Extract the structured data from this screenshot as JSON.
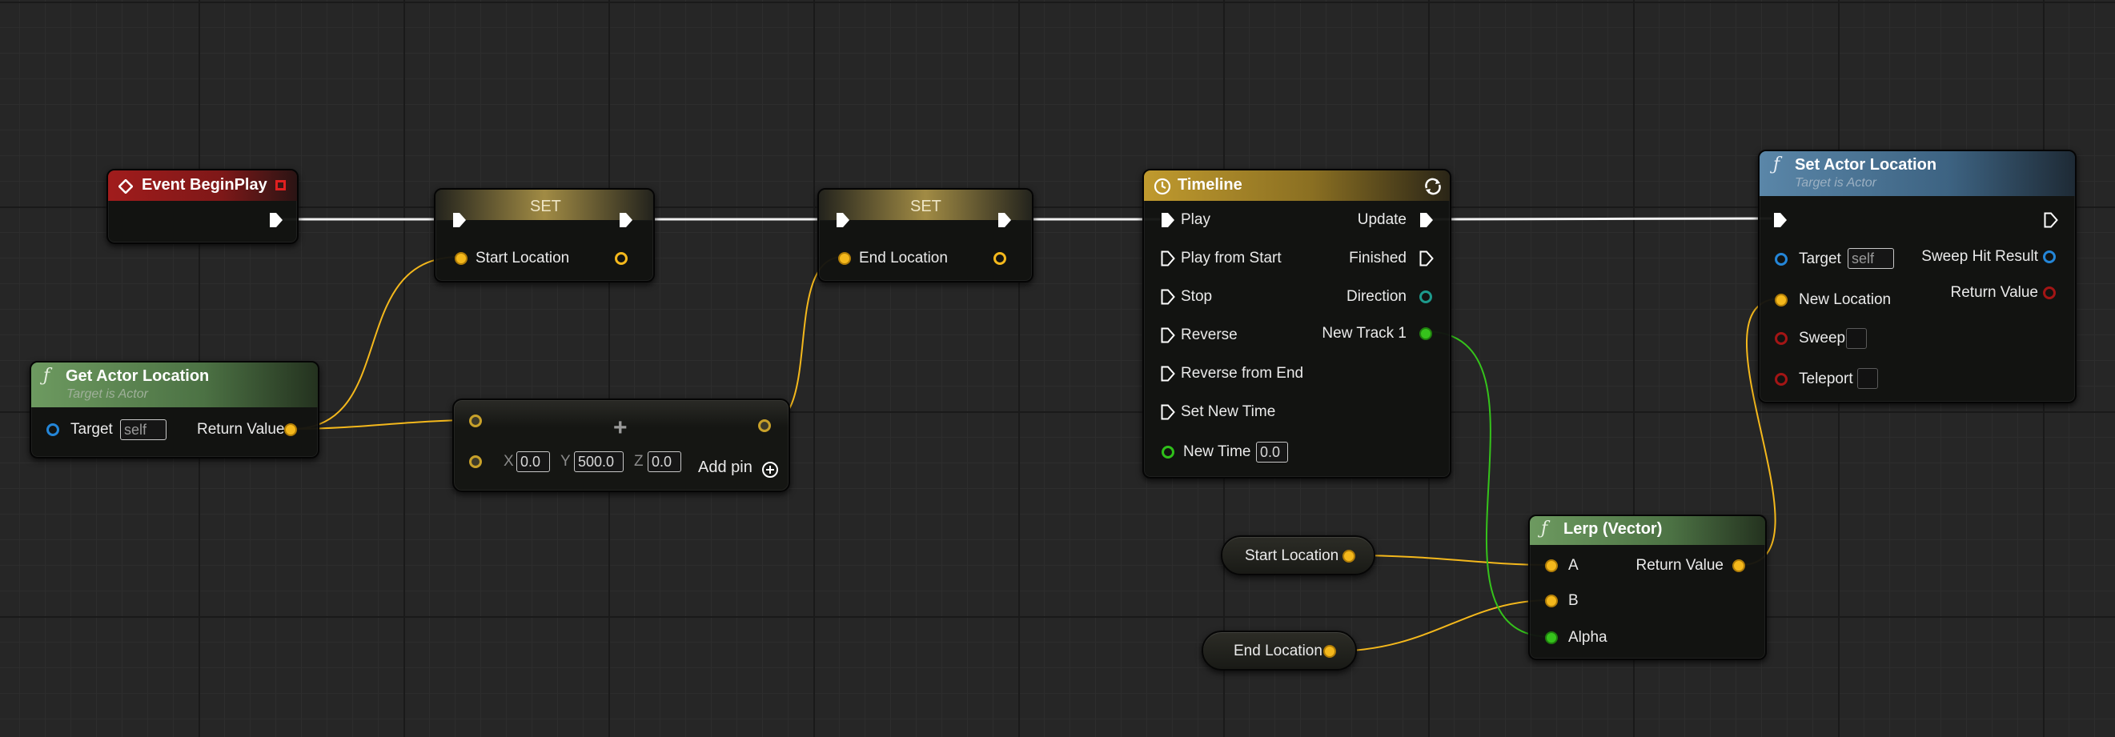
{
  "colors": {
    "exec_wire": "#f2f2f2",
    "vector_wire": "#f4b81c",
    "float_wire": "#35c31b",
    "event_header": "#9a1a1a",
    "function_header": "#6f9a62",
    "set_header": "#b39742",
    "timeline_header": "#b08a22",
    "target_function_header": "#4f7898"
  },
  "nodes": {
    "event_begin_play": {
      "title": "Event BeginPlay",
      "icon": "diamond-icon"
    },
    "get_actor_location": {
      "title": "Get Actor Location",
      "subtitle": "Target is Actor",
      "target_label": "Target",
      "target_value": "self",
      "return_label": "Return Value",
      "icon": "function-icon"
    },
    "set_start": {
      "title": "SET",
      "pin_label": "Start Location"
    },
    "set_end": {
      "title": "SET",
      "pin_label": "End Location"
    },
    "make_vector": {
      "x_label": "X",
      "x_value": "0.0",
      "y_label": "Y",
      "y_value": "500.0",
      "z_label": "Z",
      "z_value": "0.0",
      "add_pin_label": "Add pin"
    },
    "timeline": {
      "title": "Timeline",
      "icon": "clock-icon",
      "loop_icon": "loop-icon",
      "inputs": [
        "Play",
        "Play from Start",
        "Stop",
        "Reverse",
        "Reverse from End",
        "Set New Time"
      ],
      "new_time_label": "New Time",
      "new_time_value": "0.0",
      "outputs": [
        "Update",
        "Finished",
        "Direction",
        "New Track 1"
      ]
    },
    "set_actor_location": {
      "title": "Set Actor Location",
      "subtitle": "Target is Actor",
      "target_label": "Target",
      "target_value": "self",
      "new_location_label": "New Location",
      "sweep_label": "Sweep",
      "teleport_label": "Teleport",
      "sweep_hit_result_label": "Sweep Hit Result",
      "return_label": "Return Value"
    },
    "lerp": {
      "title": "Lerp (Vector)",
      "a_label": "A",
      "b_label": "B",
      "alpha_label": "Alpha",
      "return_label": "Return Value"
    },
    "get_start_location": {
      "label": "Start Location"
    },
    "get_end_location": {
      "label": "End Location"
    }
  }
}
